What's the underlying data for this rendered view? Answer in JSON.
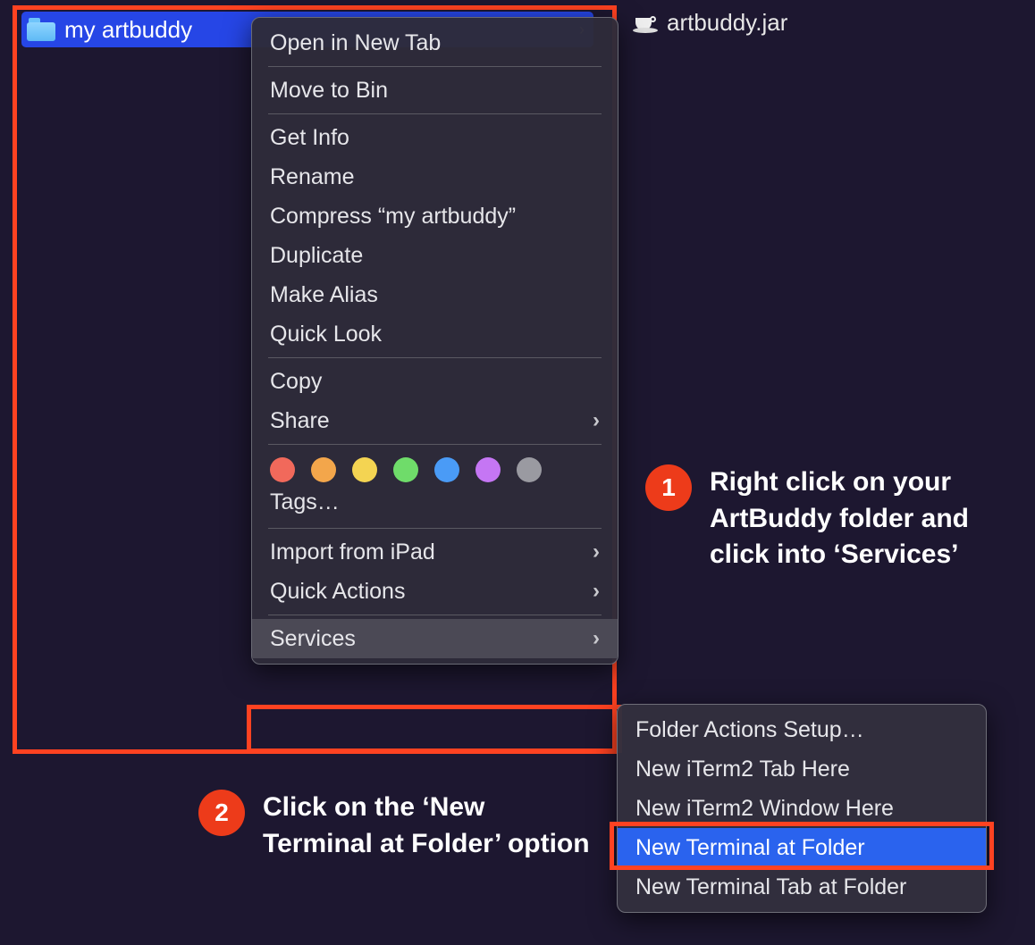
{
  "finder": {
    "folder_name": "my artbuddy",
    "jar_name": "artbuddy.jar"
  },
  "context_menu": {
    "open_new_tab": "Open in New Tab",
    "move_to_bin": "Move to Bin",
    "get_info": "Get Info",
    "rename": "Rename",
    "compress": "Compress “my artbuddy”",
    "duplicate": "Duplicate",
    "make_alias": "Make Alias",
    "quick_look": "Quick Look",
    "copy": "Copy",
    "share": "Share",
    "tags_label": "Tags…",
    "import_ipad": "Import from iPad",
    "quick_actions": "Quick Actions",
    "services": "Services",
    "tag_colors": [
      "#f1695b",
      "#f3a64b",
      "#f4d452",
      "#6fdc6a",
      "#4a9bf6",
      "#c576f4",
      "#9a9aa1"
    ]
  },
  "submenu": {
    "folder_actions": "Folder Actions Setup…",
    "iterm_tab": "New iTerm2 Tab Here",
    "iterm_window": "New iTerm2 Window Here",
    "terminal_folder": "New Terminal at Folder",
    "terminal_tab": "New Terminal Tab at Folder"
  },
  "callouts": {
    "c1_num": "1",
    "c1_text": "Right click on your ArtBuddy folder and click into ‘Services’",
    "c2_num": "2",
    "c2_text": "Click on the ‘New Terminal at Folder’ option"
  }
}
